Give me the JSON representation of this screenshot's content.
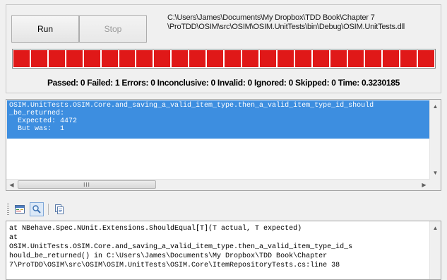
{
  "controls": {
    "run_label": "Run",
    "stop_label": "Stop",
    "assembly_path_line1": "C:\\Users\\James\\Documents\\My Dropbox\\TDD Book\\Chapter 7",
    "assembly_path_line2": "\\ProTDD\\OSIM\\src\\OSIM\\OSIM.UnitTests\\bin\\Debug\\OSIM.UnitTests.dll"
  },
  "progress": {
    "fraction": 1.0,
    "color": "#e01818",
    "segments": 24
  },
  "stats": {
    "text": "Passed: 0  Failed: 1  Errors: 0  Inconclusive: 0  Invalid: 0  Ignored: 0  Skipped: 0  Time: 0.3230185"
  },
  "results": {
    "selected_item": "OSIM.UnitTests.OSIM.Core.and_saving_a_valid_item_type.then_a_valid_item_type_id_should\n_be_returned:\n  Expected: 4472\n  But was:  1",
    "selected_color": "#3d8ee0"
  },
  "toolbar": {
    "buttons": [
      {
        "icon": "console-output-icon"
      },
      {
        "icon": "find-icon"
      },
      {
        "icon": "copy-icon"
      }
    ]
  },
  "stack_trace": {
    "text": "at NBehave.Spec.NUnit.Extensions.ShouldEqual[T](T actual, T expected)\nat\nOSIM.UnitTests.OSIM.Core.and_saving_a_valid_item_type.then_a_valid_item_type_id_s\nhould_be_returned() in C:\\Users\\James\\Documents\\My Dropbox\\TDD Book\\Chapter\n7\\ProTDD\\OSIM\\src\\OSIM\\OSIM.UnitTests\\OSIM.Core\\ItemRepositoryTests.cs:line 38"
  }
}
